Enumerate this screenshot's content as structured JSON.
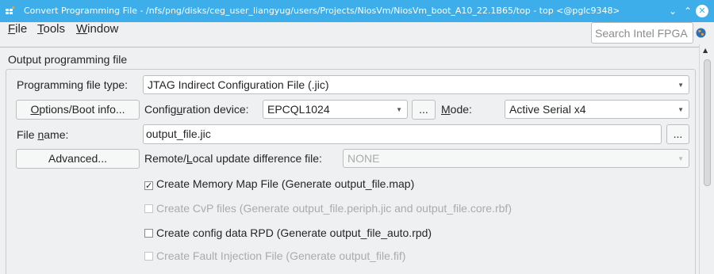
{
  "window": {
    "title": "Convert Programming File - /nfs/png/disks/ceg_user_liangyug/users/Projects/NiosVm/NiosVm_boot_A10_22.1B65/top - top <@pglc9348>",
    "minimize_glyph": "⌄",
    "maximize_glyph": "⌃",
    "close_glyph": "✕"
  },
  "menu": {
    "file": {
      "mnemonic": "F",
      "rest": "ile"
    },
    "tools": {
      "mnemonic": "T",
      "rest": "ools"
    },
    "window": {
      "mnemonic": "W",
      "rest": "indow"
    }
  },
  "search": {
    "placeholder": "Search Intel FPGA"
  },
  "section": {
    "title": "Output programming file"
  },
  "form": {
    "programming_file_type_label": "Programming file type:",
    "programming_file_type_value": "JTAG Indirect Configuration File (.jic)",
    "options_button": {
      "mnemonic": "O",
      "rest": "ptions/Boot info..."
    },
    "config_device_label": {
      "before": "Config",
      "mnemonic": "u",
      "after": "ration device:"
    },
    "config_device_value": "EPCQL1024",
    "browse_button": "...",
    "mode_label": {
      "mnemonic": "M",
      "rest": "ode:"
    },
    "mode_value": "Active Serial x4",
    "file_name_label": {
      "before": "File ",
      "mnemonic": "n",
      "after": "ame:"
    },
    "file_name_value": "output_file.jic",
    "file_browse_button": "...",
    "advanced_button": "Advanced...",
    "remote_label": {
      "before": "Remote/",
      "mnemonic": "L",
      "after": "ocal update difference file:"
    },
    "remote_value": "NONE"
  },
  "checkboxes": [
    {
      "label": "Create Memory Map File (Generate output_file.map)",
      "checked": true,
      "enabled": true,
      "mark": "✓"
    },
    {
      "label": "Create CvP files (Generate output_file.periph.jic and output_file.core.rbf)",
      "checked": false,
      "enabled": false,
      "mark": ""
    },
    {
      "label": "Create config data RPD (Generate output_file_auto.rpd)",
      "checked": false,
      "enabled": true,
      "mark": ""
    },
    {
      "label": "Create Fault Injection File (Generate output_file.fif)",
      "checked": false,
      "enabled": false,
      "mark": ""
    }
  ],
  "icons": {
    "app": "app-icon",
    "globe": "globe-icon",
    "dropdown": "chevron-down-icon"
  },
  "colors": {
    "titlebar": "#3daee9",
    "background": "#eff0f1",
    "disabled_text": "#a9abad"
  }
}
